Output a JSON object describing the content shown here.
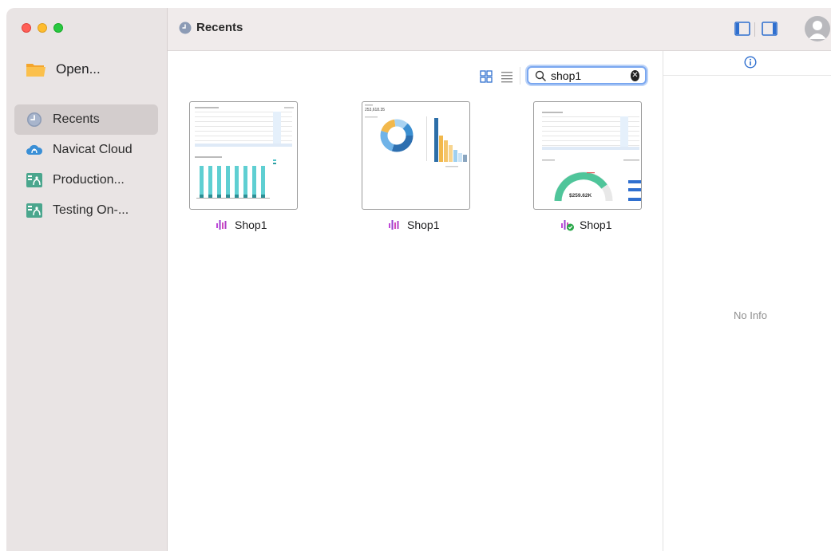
{
  "sidebar": {
    "open_label": "Open...",
    "items": [
      {
        "label": "Recents",
        "icon": "clock-icon",
        "active": true
      },
      {
        "label": "Navicat Cloud",
        "icon": "navicat-cloud-icon",
        "active": false
      },
      {
        "label": "Production...",
        "icon": "project-icon",
        "active": false
      },
      {
        "label": "Testing On-...",
        "icon": "project-icon",
        "active": false
      }
    ]
  },
  "toolbar": {
    "title": "Recents"
  },
  "search": {
    "value": "shop1",
    "placeholder": "Search"
  },
  "files": [
    {
      "name": "Shop1",
      "icon": "dashboard-icon"
    },
    {
      "name": "Shop1",
      "icon": "dashboard-icon"
    },
    {
      "name": "Shop1",
      "icon": "dashboard-synced-icon"
    }
  ],
  "thumbnail_texts": {
    "card2_value": "253,618.35",
    "card3_value": "$259.62K"
  },
  "info": {
    "empty_text": "No Info"
  },
  "colors": {
    "accent": "#3b82f6",
    "sidebar_bg": "#e9e4e4",
    "dashboard_icon": "#b03fc9"
  }
}
